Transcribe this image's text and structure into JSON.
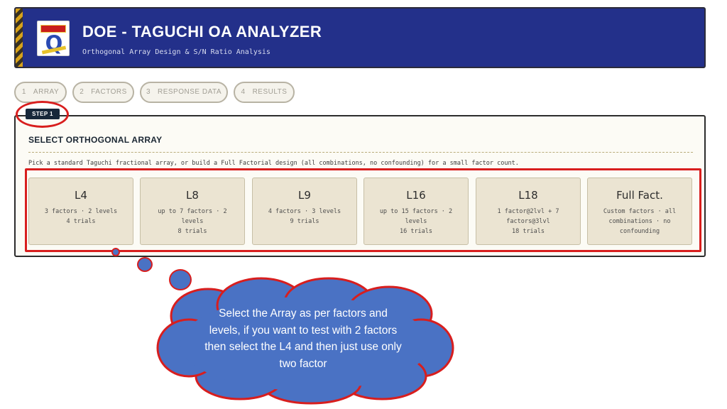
{
  "header": {
    "title": "DOE - TAGUCHI OA ANALYZER",
    "subtitle": "Orthogonal Array Design & S/N Ratio Analysis",
    "logo_icon": "q-logo-icon"
  },
  "tabs": [
    {
      "num": "1",
      "label": "ARRAY"
    },
    {
      "num": "2",
      "label": "FACTORS"
    },
    {
      "num": "3",
      "label": "RESPONSE DATA"
    },
    {
      "num": "4",
      "label": "RESULTS"
    }
  ],
  "step_badge": "STEP 1",
  "panel": {
    "title": "SELECT ORTHOGONAL ARRAY",
    "description": "Pick a standard Taguchi fractional array, or build a Full Factorial design (all combinations, no confounding) for a small factor count."
  },
  "arrays": [
    {
      "name": "L4",
      "desc": "3 factors · 2 levels",
      "trials": "4 trials"
    },
    {
      "name": "L8",
      "desc": "up to 7 factors · 2 levels",
      "trials": "8 trials"
    },
    {
      "name": "L9",
      "desc": "4 factors · 3 levels",
      "trials": "9 trials"
    },
    {
      "name": "L16",
      "desc": "up to 15 factors · 2 levels",
      "trials": "16 trials"
    },
    {
      "name": "L18",
      "desc": "1 factor@2lvl + 7 factors@3lvl",
      "trials": "18 trials"
    },
    {
      "name": "Full Fact.",
      "desc": "Custom factors · all combinations · no confounding",
      "trials": ""
    }
  ],
  "callout": {
    "text": "Select the Array as per factors and levels, if you want to test with 2 factors then select the L4 and then just use only two factor"
  },
  "colors": {
    "header_bg": "#23308a",
    "highlight_red": "#d81e1e",
    "card_bg": "#ebe4d2",
    "callout_fill": "#4a72c4"
  }
}
